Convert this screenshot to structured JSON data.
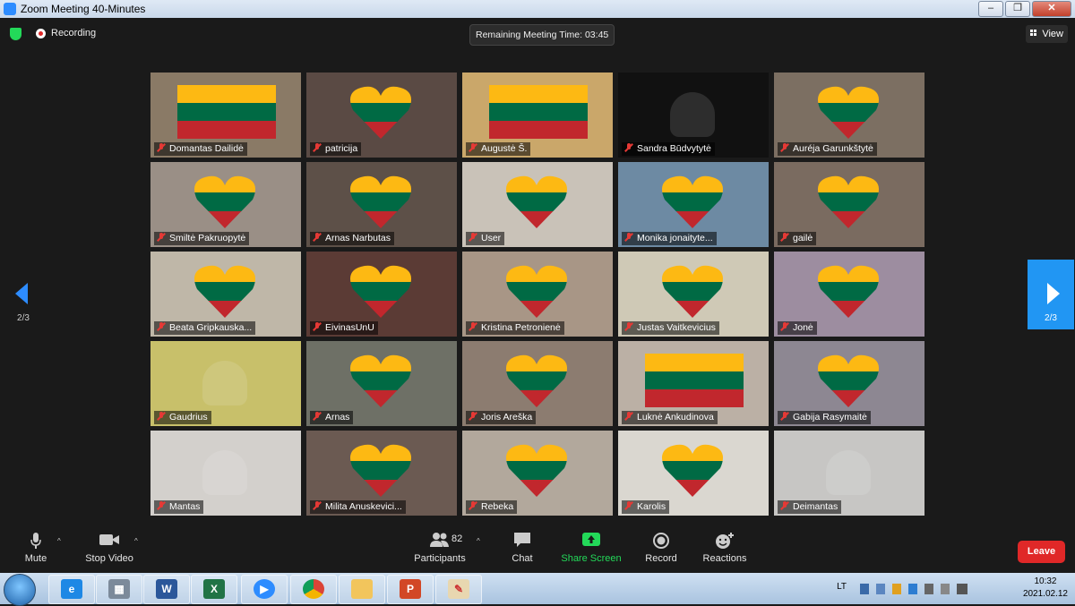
{
  "window": {
    "title": "Zoom Meeting 40-Minutes",
    "minimize": "–",
    "restore": "❐",
    "close": "✕"
  },
  "topbar": {
    "recording_label": "Recording",
    "timer_text": "Remaining Meeting Time: 03:45",
    "view_label": "View"
  },
  "participants": [
    {
      "name": "Domantas Dailidė"
    },
    {
      "name": "patricija"
    },
    {
      "name": "Augustė Š."
    },
    {
      "name": "Sandra Būdvytytė"
    },
    {
      "name": "Auréja Garunkštytė"
    },
    {
      "name": "Smiltė Pakruopytė"
    },
    {
      "name": "Arnas Narbutas"
    },
    {
      "name": "User"
    },
    {
      "name": "Monika jonaityte..."
    },
    {
      "name": "gailė"
    },
    {
      "name": "Beata Gripkauska..."
    },
    {
      "name": "EivinasUnU"
    },
    {
      "name": "Kristina Petronienė"
    },
    {
      "name": "Justas Vaitkevicius"
    },
    {
      "name": "Jonė"
    },
    {
      "name": "Gaudrius"
    },
    {
      "name": "Arnas"
    },
    {
      "name": "Joris Areška"
    },
    {
      "name": "Luknė Ankudinova"
    },
    {
      "name": "Gabija Rasymaitė"
    },
    {
      "name": "Mantas"
    },
    {
      "name": "Milita Anuskevici..."
    },
    {
      "name": "Rebeka"
    },
    {
      "name": "Karolis"
    },
    {
      "name": "Deimantas"
    }
  ],
  "pager": {
    "left_page": "2/3",
    "right_page": "2/3"
  },
  "controls": {
    "mute": "Mute",
    "stop_video": "Stop Video",
    "participants": "Participants",
    "participant_count": "82",
    "chat": "Chat",
    "share_screen": "Share Screen",
    "record": "Record",
    "reactions": "Reactions",
    "leave": "Leave"
  },
  "taskbar": {
    "apps": [
      "internet-explorer",
      "calculator",
      "word",
      "excel",
      "zoom",
      "chrome",
      "file-explorer",
      "powerpoint",
      "paint"
    ],
    "language": "LT",
    "time": "10:32",
    "date": "2021.02.12"
  },
  "colors": {
    "flag_yellow": "#fdb913",
    "flag_green": "#006a44",
    "flag_red": "#c1272d",
    "zoom_blue": "#2d8cff",
    "leave_red": "#e02828",
    "share_green": "#23d959"
  }
}
